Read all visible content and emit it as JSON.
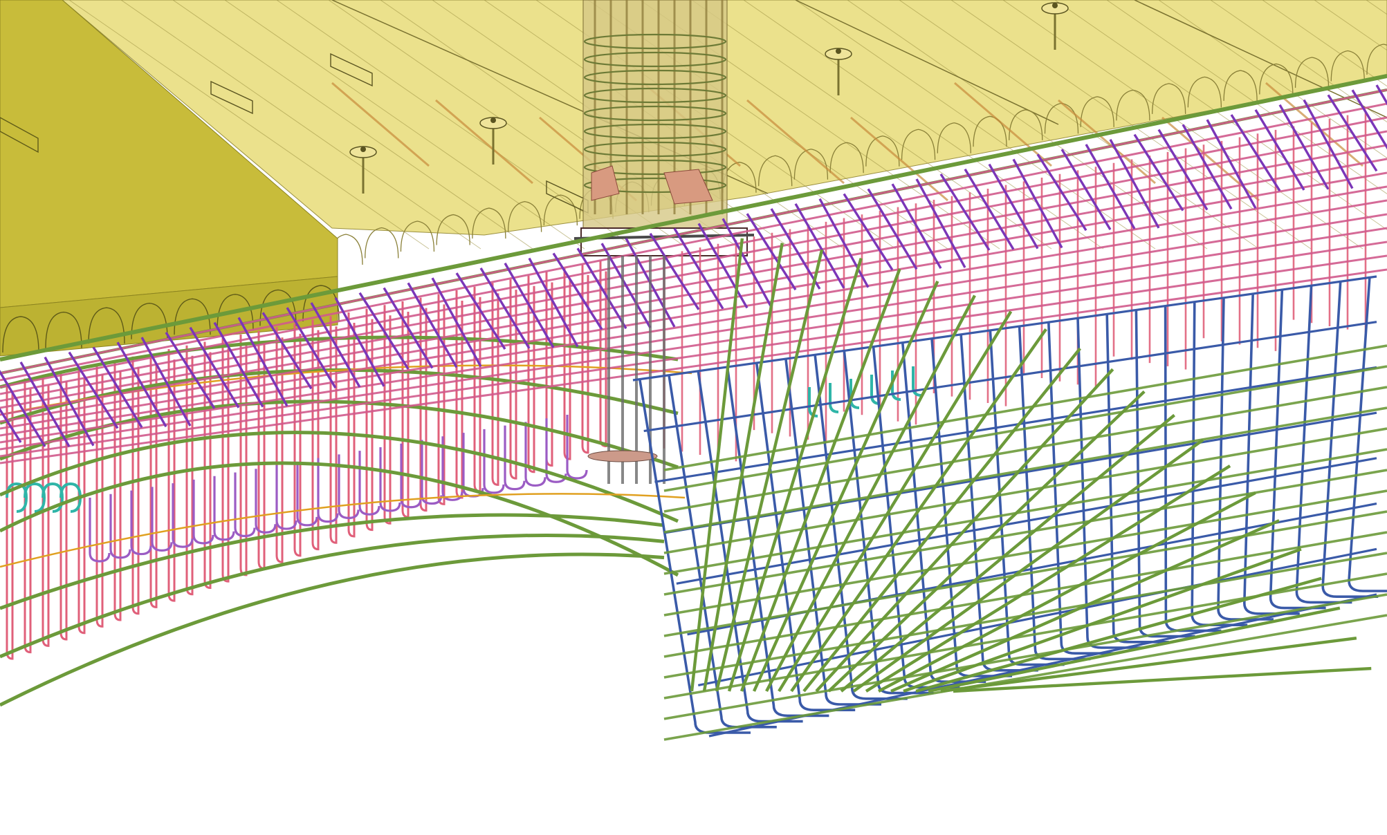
{
  "scene": {
    "kind": "3d-rebar-model-view",
    "visible_text": []
  },
  "colors": {
    "background": "#ffffff",
    "slab_solid": "#c8bc3a",
    "slab_solid_edge": "#8c8420",
    "slab_translucent": "#e8dc78",
    "slab_line": "#9a9040",
    "slab_stripe": "#c88a3a",
    "column_shell": "#d6c886",
    "column_bar": "#8c7a3a",
    "column_cap": "#d89a80",
    "top_mesh_long": "#7a36b8",
    "top_mesh_cross": "#d05a8c",
    "edge_green": "#6c9a3a",
    "stirrup_pink": "#e0607a",
    "hook_purple": "#9b5cc4",
    "hook_teal": "#2fb5a8",
    "cage_blue": "#3a5aa8",
    "orange_bar": "#e0a020",
    "anchor_gray": "#6a6a6a"
  },
  "icons": [
    "shear-stud-icon",
    "lifting-insert-icon"
  ]
}
